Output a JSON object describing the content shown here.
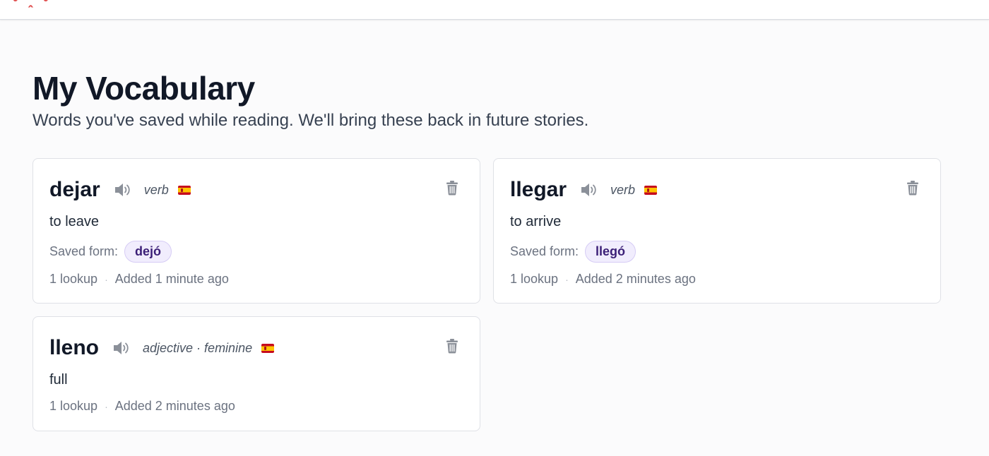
{
  "header": {
    "title": "My Vocabulary",
    "subtitle": "Words you've saved while reading. We'll bring these back in future stories."
  },
  "colors": {
    "accent_chip_bg": "#f1edfd",
    "accent_chip_text": "#3b1f77",
    "brand_red": "#e05252"
  },
  "cards": [
    {
      "word": "dejar",
      "part_of_speech": "verb",
      "meaning": "to leave",
      "saved_form_label": "Saved form:",
      "saved_form": "dejó",
      "lookups": "1 lookup",
      "separator": "·",
      "added": "Added 1 minute ago",
      "speaker_icon": "speaker-icon",
      "flag_icon": "spain-flag-icon",
      "delete_icon": "trash-icon"
    },
    {
      "word": "llegar",
      "part_of_speech": "verb",
      "meaning": "to arrive",
      "saved_form_label": "Saved form:",
      "saved_form": "llegó",
      "lookups": "1 lookup",
      "separator": "·",
      "added": "Added 2 minutes ago",
      "speaker_icon": "speaker-icon",
      "flag_icon": "spain-flag-icon",
      "delete_icon": "trash-icon"
    },
    {
      "word": "lleno",
      "part_of_speech": "adjective · feminine",
      "meaning": "full",
      "lookups": "1 lookup",
      "separator": "·",
      "added": "Added 2 minutes ago",
      "speaker_icon": "speaker-icon",
      "flag_icon": "spain-flag-icon",
      "delete_icon": "trash-icon"
    }
  ]
}
